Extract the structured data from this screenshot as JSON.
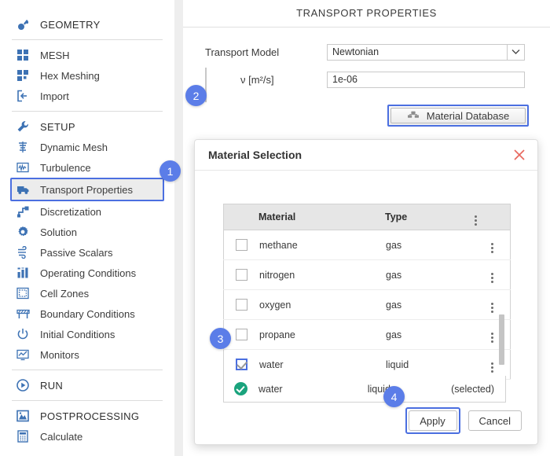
{
  "sidebar": {
    "items": [
      {
        "label": "GEOMETRY",
        "icon": "geometry-icon",
        "kind": "section"
      },
      {
        "label": "MESH",
        "icon": "mesh-icon",
        "kind": "section"
      },
      {
        "label": "Hex Meshing",
        "icon": "hex-meshing-icon",
        "kind": "item"
      },
      {
        "label": "Import",
        "icon": "import-icon",
        "kind": "item"
      },
      {
        "label": "SETUP",
        "icon": "setup-wrench-icon",
        "kind": "section"
      },
      {
        "label": "Dynamic Mesh",
        "icon": "dynamic-mesh-icon",
        "kind": "item"
      },
      {
        "label": "Turbulence",
        "icon": "turbulence-icon",
        "kind": "item"
      },
      {
        "label": "Transport Properties",
        "icon": "transport-truck-icon",
        "kind": "item",
        "selected": true
      },
      {
        "label": "Discretization",
        "icon": "discretization-icon",
        "kind": "item"
      },
      {
        "label": "Solution",
        "icon": "solution-gear-icon",
        "kind": "item"
      },
      {
        "label": "Passive Scalars",
        "icon": "passive-scalars-icon",
        "kind": "item"
      },
      {
        "label": "Operating Conditions",
        "icon": "operating-conditions-icon",
        "kind": "item"
      },
      {
        "label": "Cell Zones",
        "icon": "cell-zones-icon",
        "kind": "item"
      },
      {
        "label": "Boundary Conditions",
        "icon": "boundary-conditions-icon",
        "kind": "item"
      },
      {
        "label": "Initial Conditions",
        "icon": "initial-conditions-icon",
        "kind": "item"
      },
      {
        "label": "Monitors",
        "icon": "monitors-icon",
        "kind": "item"
      },
      {
        "label": "RUN",
        "icon": "run-play-icon",
        "kind": "section"
      },
      {
        "label": "POSTPROCESSING",
        "icon": "postprocessing-icon",
        "kind": "section"
      },
      {
        "label": "Calculate",
        "icon": "calculate-icon",
        "kind": "item"
      }
    ]
  },
  "main": {
    "title": "TRANSPORT PROPERTIES",
    "transport_model_label": "Transport Model",
    "transport_model_value": "Newtonian",
    "nu_label": "ν [m²/s]",
    "nu_value": "1e-06",
    "material_database_button": "Material Database"
  },
  "dialog": {
    "title": "Material Selection",
    "close_icon": "close-x-icon",
    "columns": [
      "Material",
      "Type"
    ],
    "rows": [
      {
        "material": "methane",
        "type": "gas",
        "checked": false
      },
      {
        "material": "nitrogen",
        "type": "gas",
        "checked": false
      },
      {
        "material": "oxygen",
        "type": "gas",
        "checked": false
      },
      {
        "material": "propane",
        "type": "gas",
        "checked": false
      },
      {
        "material": "water",
        "type": "liquid",
        "checked": true
      }
    ],
    "selected_row": {
      "material": "water",
      "type": "liquid",
      "status": "(selected)"
    },
    "apply_label": "Apply",
    "cancel_label": "Cancel"
  },
  "badges": {
    "one": "1",
    "two": "2",
    "three": "3",
    "four": "4"
  },
  "colors": {
    "accent_blue": "#5b7de8",
    "icon_blue": "#3d72b4",
    "selected_green": "#1aa37d",
    "close_red": "#e8685f"
  }
}
